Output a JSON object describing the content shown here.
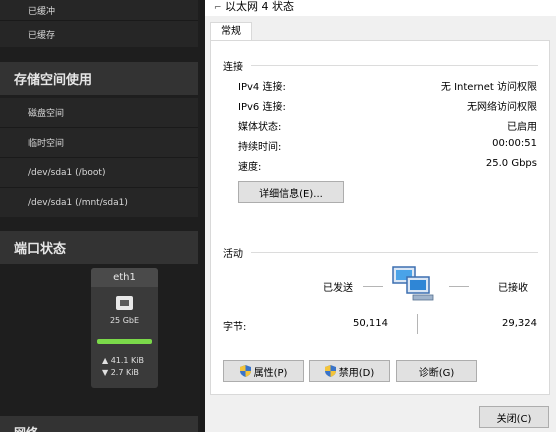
{
  "left_panel": {
    "top_items": [
      "已缓冲",
      "已缓存"
    ],
    "storage_section": "存储空间使用",
    "storage_items": [
      "磁盘空间",
      "临时空间",
      "/dev/sda1 (/boot)",
      "/dev/sda1 (/mnt/sda1)"
    ],
    "port_section": "端口状态",
    "port": {
      "name": "eth1",
      "speed": "25 GbE",
      "link_fraction": 1.0,
      "tx": "▲ 41.1  KiB",
      "rx": "▼ 2.7  KiB"
    },
    "bottom_section_partial": "网络"
  },
  "dialog": {
    "title": "以太网 4 状态",
    "tab": "常规",
    "connection": {
      "heading": "连接",
      "rows": [
        {
          "label": "IPv4 连接:",
          "value": "无 Internet 访问权限"
        },
        {
          "label": "IPv6 连接:",
          "value": "无网络访问权限"
        },
        {
          "label": "媒体状态:",
          "value": "已启用"
        },
        {
          "label": "持续时间:",
          "value": "00:00:51"
        },
        {
          "label": "速度:",
          "value": "25.0 Gbps"
        }
      ],
      "details_button": "详细信息(E)..."
    },
    "activity": {
      "heading": "活动",
      "sent_label": "已发送",
      "received_label": "已接收",
      "bytes_label": "字节:",
      "bytes_sent": "50,114",
      "bytes_received": "29,324"
    },
    "buttons": {
      "properties": "属性(P)",
      "disable": "禁用(D)",
      "diagnose": "诊断(G)",
      "close": "关闭(C)"
    }
  }
}
